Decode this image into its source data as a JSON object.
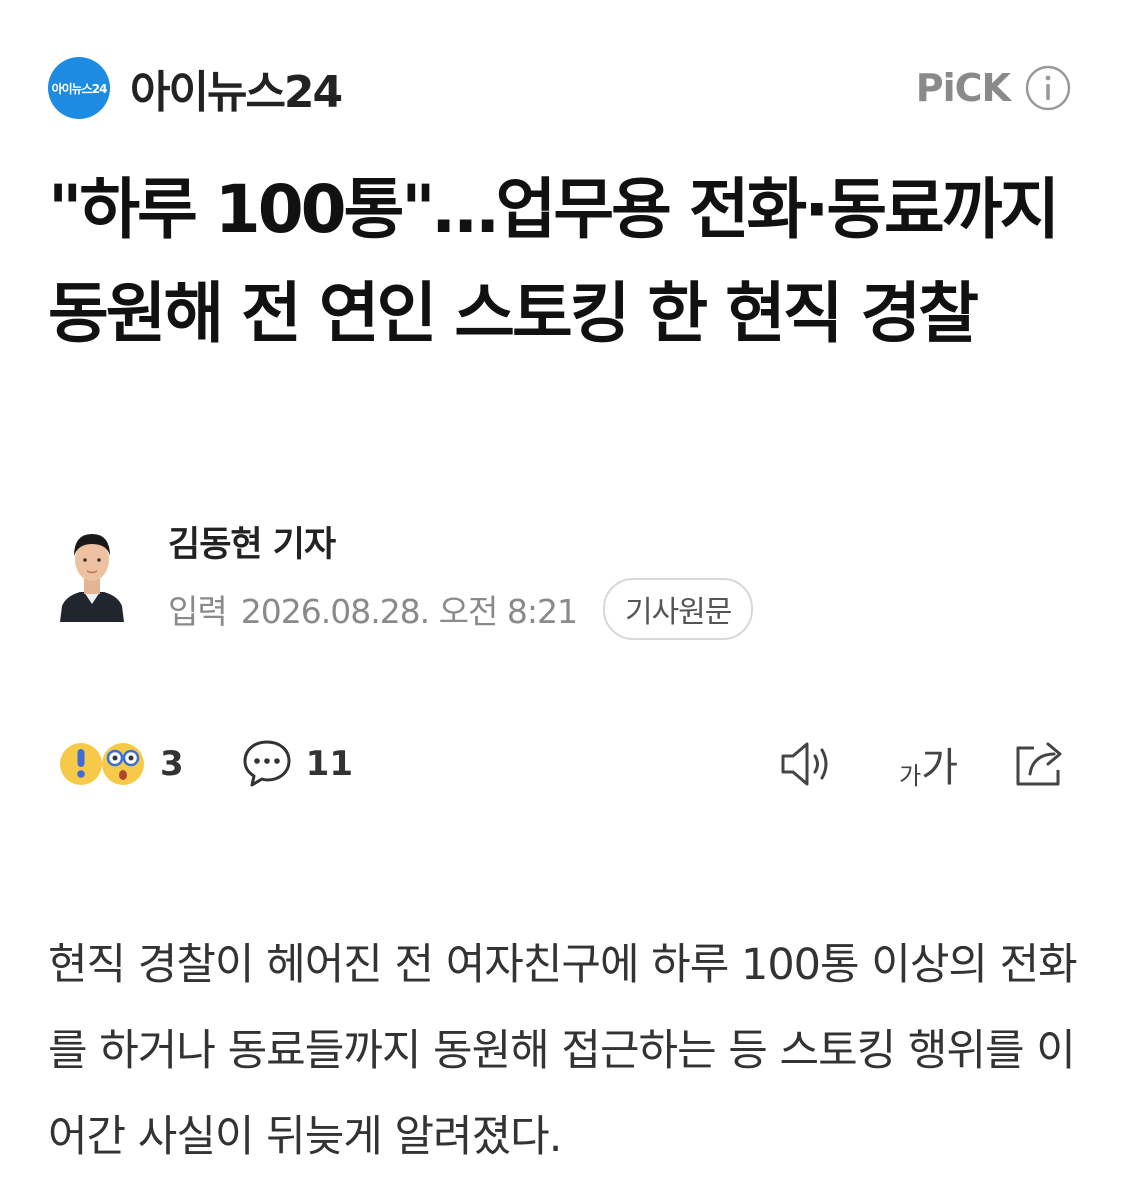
{
  "header": {
    "press_logo_text": "아이뉴스24",
    "press_name": "아이뉴스24",
    "pick_label": "PiCK",
    "logo_color": "#1e8be3"
  },
  "article": {
    "title": "\"하루 100통\"…업무용 전화·동료까지 동원해 전 연인 스토킹 한 현직 경찰",
    "reporter": "김동현 기자",
    "date_label": "입력",
    "date_value": "2026.08.28. 오전 8:21",
    "origin_button": "기사원문",
    "body": "현직 경찰이 헤어진 전 여자친구에 하루 100통 이상의 전화를 하거나 동료들까지 동원해 접근하는 등 스토킹 행위를 이어간 사실이 뒤늦게 알려졌다."
  },
  "actions": {
    "reaction_icons": [
      "surprised-emoji-icon",
      "shocked-emoji-icon"
    ],
    "reaction_count": "3",
    "comment_count": "11",
    "font_small": "가",
    "font_large": "가",
    "tool_icons": [
      "speaker-icon",
      "font-size-icon",
      "share-icon"
    ]
  }
}
